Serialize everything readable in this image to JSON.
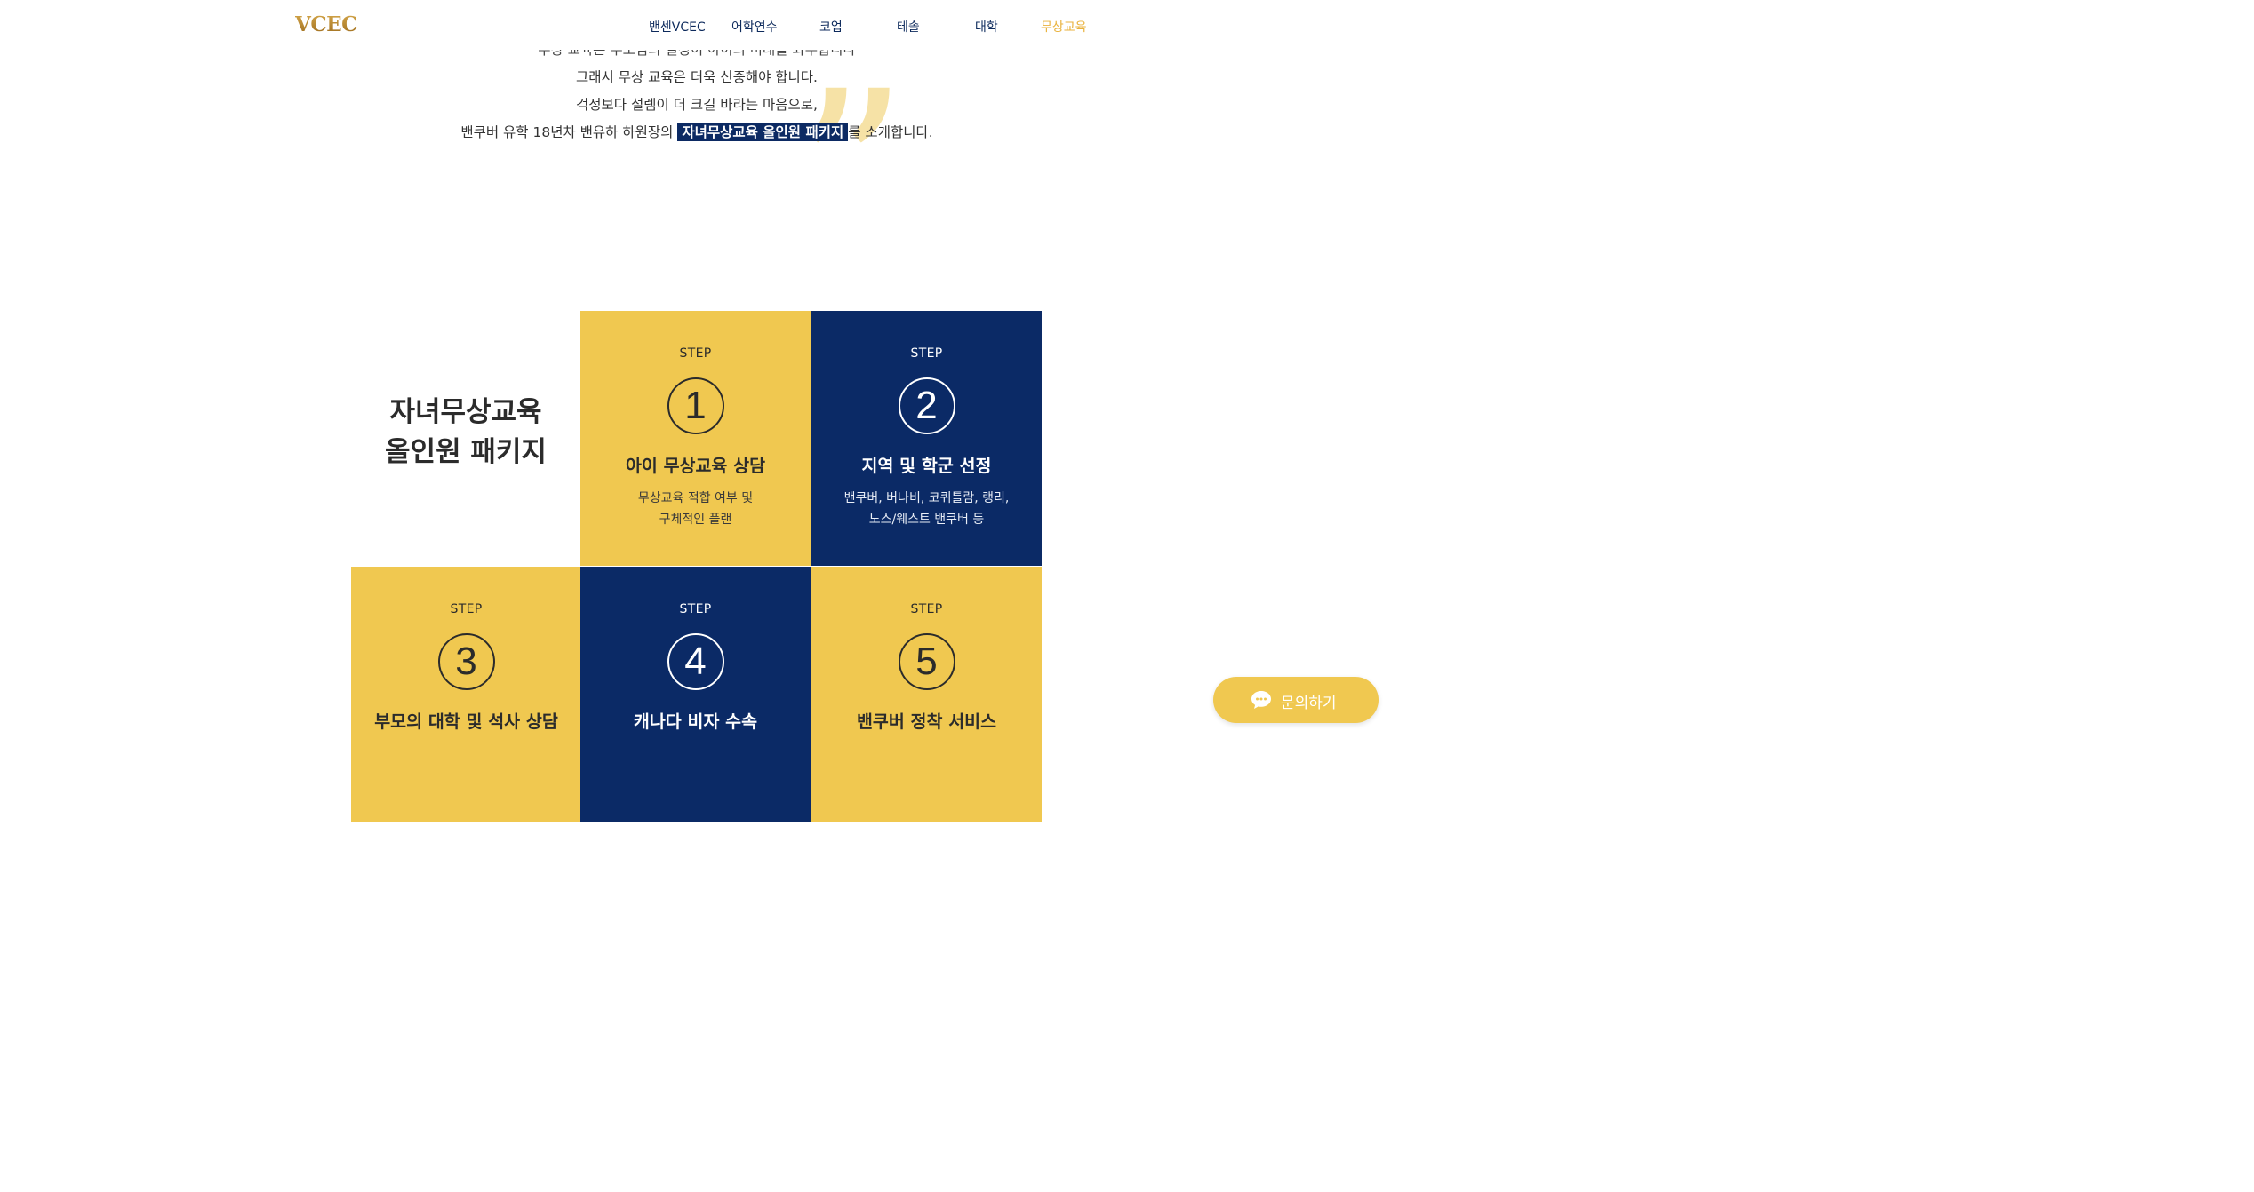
{
  "header": {
    "logo": "VCEC",
    "nav": [
      "밴센VCEC",
      "어학연수",
      "코업",
      "테솔",
      "대학",
      "무상교육"
    ],
    "active_nav": "무상교육"
  },
  "intro": {
    "cut_line": "무상 교육은 부모님의 결정이 아이의 미래를 좌우합니다",
    "line1": "그래서 무상 교육은 더욱 신중해야 합니다.",
    "line2": "걱정보다 설렘이 더 크길 바라는 마음으로,",
    "line3_prefix": "밴쿠버 유학 18년차 밴유하 하원장의",
    "line3_highlight": "자녀무상교육 올인원 패키지",
    "line3_suffix": "를 소개합니다.",
    "quote_mark": "”"
  },
  "package": {
    "title_line1": "자녀무상교육",
    "title_line2": "올인원 패키지",
    "steps": [
      {
        "label": "STEP",
        "number": "1",
        "title": "아이 무상교육 상담",
        "desc_line1": "무상교육 적합 여부 및",
        "desc_line2": "구체적인 플랜"
      },
      {
        "label": "STEP",
        "number": "2",
        "title": "지역 및 학군 선정",
        "desc_line1": "밴쿠버, 버나비, 코퀴틀람, 랭리,",
        "desc_line2": "노스/웨스트 밴쿠버 등"
      },
      {
        "label": "STEP",
        "number": "3",
        "title": "부모의 대학 및 석사 상담",
        "desc_line1": "",
        "desc_line2": ""
      },
      {
        "label": "STEP",
        "number": "4",
        "title": "캐나다 비자 수속",
        "desc_line1": "",
        "desc_line2": ""
      },
      {
        "label": "STEP",
        "number": "5",
        "title": "밴쿠버 정착 서비스",
        "desc_line1": "",
        "desc_line2": ""
      }
    ]
  },
  "chat": {
    "label": "문의하기",
    "icon": "chat-bubble-icon"
  },
  "colors": {
    "navy": "#0b2a66",
    "yellow": "#f0c850",
    "gold": "#b8852c",
    "quote": "#f6e2a6"
  }
}
